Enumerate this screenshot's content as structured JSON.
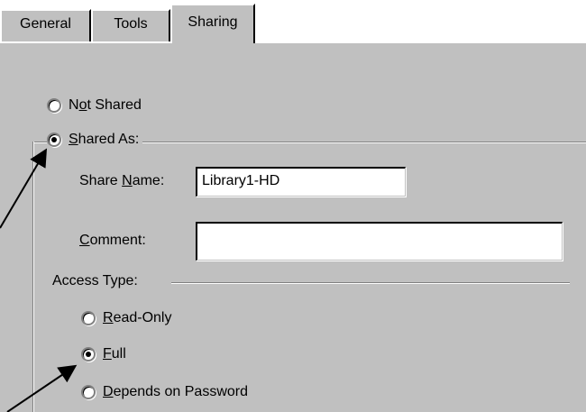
{
  "tabs": [
    {
      "label": "General"
    },
    {
      "label": "Tools"
    },
    {
      "label": "Sharing",
      "active": true
    }
  ],
  "sharing": {
    "not_shared": {
      "label": "Not Shared",
      "mnemonic_index": 1,
      "selected": false
    },
    "shared_as": {
      "label": "Shared As:",
      "mnemonic_index": 0,
      "selected": true
    },
    "share_name": {
      "label": "Share Name:",
      "value": "Library1-HD"
    },
    "comment": {
      "label": "Comment:",
      "value": ""
    },
    "access_type": {
      "label": "Access Type:",
      "options": [
        {
          "label": "Read-Only",
          "mnemonic_index": 0,
          "selected": false
        },
        {
          "label": "Full",
          "mnemonic_index": 0,
          "selected": true
        },
        {
          "label": "Depends on Password",
          "mnemonic_index": 0,
          "selected": false
        }
      ]
    }
  },
  "colors": {
    "dialog_face": "#c0c0c0",
    "highlight": "#ffffff",
    "shadow": "#808080",
    "text": "#000000"
  }
}
